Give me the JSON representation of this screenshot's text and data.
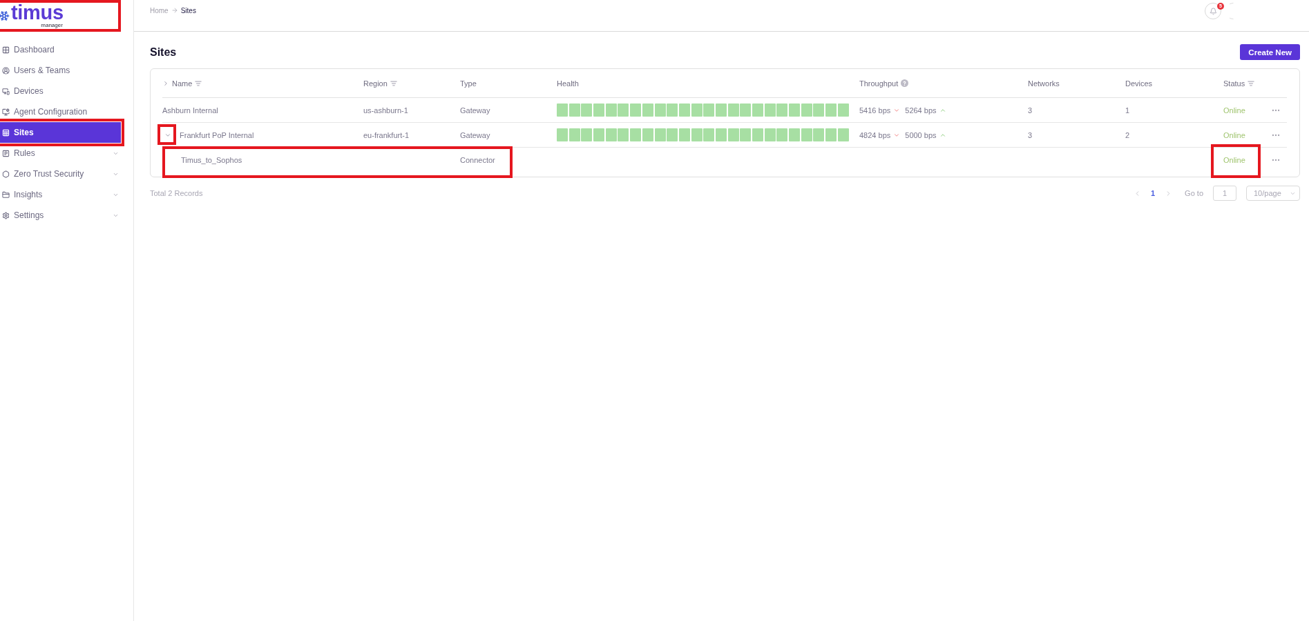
{
  "logo": {
    "name": "timus",
    "tagline": "manager",
    "highlighted": true
  },
  "sidebar": {
    "items": [
      {
        "label": "Dashboard",
        "selected": false,
        "submenu": false,
        "highlighted": false
      },
      {
        "label": "Users & Teams",
        "selected": false,
        "submenu": false,
        "highlighted": false
      },
      {
        "label": "Devices",
        "selected": false,
        "submenu": false,
        "highlighted": false
      },
      {
        "label": "Agent Configuration",
        "selected": false,
        "submenu": false,
        "highlighted": false
      },
      {
        "label": "Sites",
        "selected": true,
        "submenu": false,
        "highlighted": true
      },
      {
        "label": "Rules",
        "selected": false,
        "submenu": true,
        "highlighted": false
      },
      {
        "label": "Zero Trust Security",
        "selected": false,
        "submenu": true,
        "highlighted": false
      },
      {
        "label": "Insights",
        "selected": false,
        "submenu": true,
        "highlighted": false
      },
      {
        "label": "Settings",
        "selected": false,
        "submenu": true,
        "highlighted": false
      }
    ]
  },
  "header": {
    "breadcrumb": [
      {
        "label": "Home",
        "current": false
      },
      {
        "label": "Sites",
        "current": true
      }
    ],
    "notifications": {
      "count": "5"
    }
  },
  "page": {
    "title": "Sites",
    "create_button": "Create New"
  },
  "table": {
    "expand_all": {
      "expanded": false
    },
    "columns": [
      {
        "label": "Name",
        "filter": true,
        "help": false
      },
      {
        "label": "Region",
        "filter": true,
        "help": false
      },
      {
        "label": "Type",
        "filter": false,
        "help": false
      },
      {
        "label": "Health",
        "filter": false,
        "help": false
      },
      {
        "label": "Throughput",
        "filter": false,
        "help": true
      },
      {
        "label": "Networks",
        "filter": false,
        "help": false
      },
      {
        "label": "Devices",
        "filter": false,
        "help": false
      },
      {
        "label": "Status",
        "filter": true,
        "help": false
      }
    ],
    "rows": [
      {
        "name": "Ashburn Internal",
        "region": "us-ashburn-1",
        "type": "Gateway",
        "health": [
          {
            "healthy": true
          },
          {
            "healthy": true
          },
          {
            "healthy": true
          },
          {
            "healthy": true
          },
          {
            "healthy": true
          },
          {
            "healthy": true
          },
          {
            "healthy": true
          },
          {
            "healthy": true
          },
          {
            "healthy": true
          },
          {
            "healthy": true
          },
          {
            "healthy": true
          },
          {
            "healthy": true
          },
          {
            "healthy": true
          },
          {
            "healthy": true
          },
          {
            "healthy": true
          },
          {
            "healthy": true
          },
          {
            "healthy": true
          },
          {
            "healthy": true
          },
          {
            "healthy": true
          },
          {
            "healthy": true
          },
          {
            "healthy": true
          },
          {
            "healthy": true
          },
          {
            "healthy": true
          },
          {
            "healthy": true
          }
        ],
        "throughput": {
          "down": "5416 bps",
          "up": "5264 bps"
        },
        "networks": "3",
        "devices": "1",
        "status": {
          "label": "Online",
          "color": "#9fc46e"
        },
        "highlighted": false,
        "status_highlighted": false
      },
      {
        "name": "Frankfurt PoP Internal",
        "region": "eu-frankfurt-1",
        "type": "Gateway",
        "health": [
          {
            "healthy": true
          },
          {
            "healthy": true
          },
          {
            "healthy": true
          },
          {
            "healthy": true
          },
          {
            "healthy": true
          },
          {
            "healthy": true
          },
          {
            "healthy": true
          },
          {
            "healthy": true
          },
          {
            "healthy": true
          },
          {
            "healthy": true
          },
          {
            "healthy": true
          },
          {
            "healthy": true
          },
          {
            "healthy": true
          },
          {
            "healthy": true
          },
          {
            "healthy": true
          },
          {
            "healthy": true
          },
          {
            "healthy": true
          },
          {
            "healthy": true
          },
          {
            "healthy": true
          },
          {
            "healthy": true
          },
          {
            "healthy": true
          },
          {
            "healthy": true
          },
          {
            "healthy": true
          },
          {
            "healthy": true
          }
        ],
        "throughput": {
          "down": "4824 bps",
          "up": "5000 bps"
        },
        "networks": "3",
        "devices": "2",
        "status": {
          "label": "Online",
          "color": "#9fc46e"
        },
        "highlighted": false,
        "status_highlighted": false,
        "expanded": true,
        "toggle_highlighted": true,
        "children": [
          {
            "name": "Timus_to_Sophos",
            "type": "Connector",
            "status": {
              "label": "Online",
              "color": "#9fc46e"
            },
            "highlighted": true,
            "status_highlighted": true
          }
        ]
      }
    ]
  },
  "footer": {
    "total": "Total 2 Records",
    "pagination": {
      "prev_disabled": true,
      "pages": [
        {
          "label": "1",
          "selected": true
        }
      ],
      "next_disabled": true,
      "goto_label": "Go to",
      "goto_value": "1",
      "page_size": "10/page"
    }
  }
}
